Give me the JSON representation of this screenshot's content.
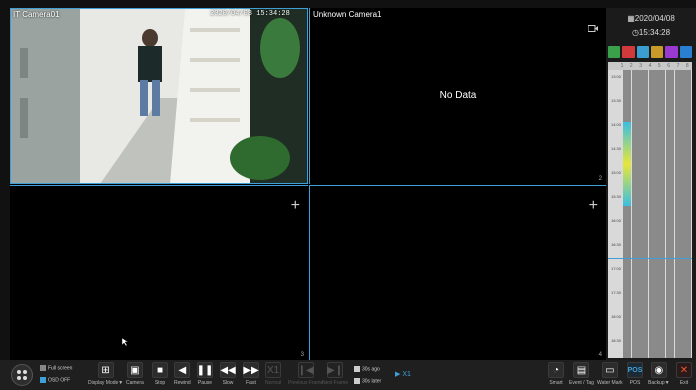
{
  "tiles": {
    "t1": {
      "title": "IT Camera01",
      "osd_time": "2020/04/08 15:34:28"
    },
    "t2": {
      "title": "Unknown Camera1",
      "message": "No Data",
      "number": "2"
    },
    "t3": {
      "number": "3"
    },
    "t4": {
      "number": "4"
    }
  },
  "sidebar": {
    "date": "2020/04/08",
    "time": "15:34:28",
    "channel_header": [
      "1",
      "2",
      "3",
      "4",
      "5",
      "6",
      "7",
      "8"
    ],
    "time_labels": [
      "13:00",
      "13:30",
      "14:00",
      "14:30",
      "15:00",
      "15:30",
      "16:00",
      "16:30",
      "17:00",
      "17:30",
      "18:00",
      "18:30"
    ]
  },
  "toolbar": {
    "fullscreen": "Full screen",
    "osd_off": "OSD OFF",
    "display_mode": "Display Mode▼",
    "camera": "Camera",
    "stop": "Stop",
    "rewind": "Rewind",
    "pause": "Pause",
    "slow": "Slow",
    "fast": "Fast",
    "normal_ic": "X1",
    "normal": "Normal",
    "prev_frame": "Previous Frame",
    "next_frame": "Next Frame",
    "ago": "30s ago",
    "later": "30s later",
    "speed": "X1",
    "smart": "Smart",
    "event_tag": "Event / Tag",
    "water_mark": "Water Mark",
    "pos_ic": "POS",
    "pos": "POS",
    "backup": "Backup▼",
    "exit": "Exit"
  },
  "colors": {
    "accent": "#3fa0d8",
    "record": "#3cbfe0",
    "motion": "#e6e63c"
  }
}
